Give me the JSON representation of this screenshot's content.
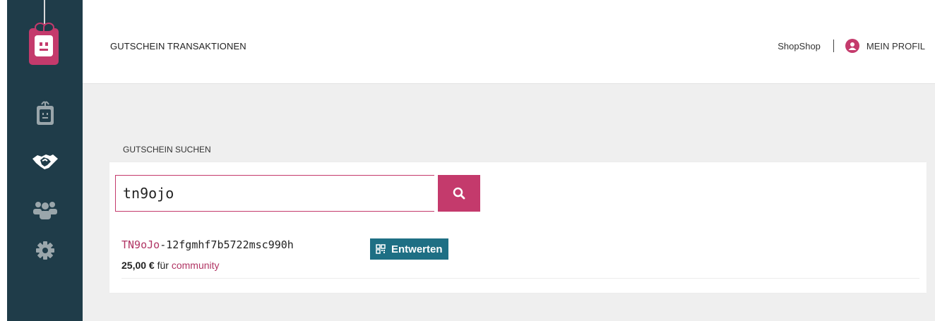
{
  "header": {
    "title": "GUTSCHEIN TRANSAKTIONEN",
    "shop_name": "ShopShop",
    "profile_label": "MEIN PROFIL"
  },
  "sidebar": {
    "logo_icon": "gift-robot-logo-icon",
    "items": [
      {
        "icon": "gift-box-icon",
        "active": false
      },
      {
        "icon": "handshake-icon",
        "active": true
      },
      {
        "icon": "users-icon",
        "active": false
      },
      {
        "icon": "gear-icon",
        "active": false
      }
    ]
  },
  "search": {
    "section_label": "GUTSCHEIN SUCHEN",
    "value": "tn9ojo",
    "button_icon": "search-icon"
  },
  "result": {
    "code_prefix": "TN9oJo",
    "code_rest": "-12fgmhf7b5722msc990h",
    "redeem_label": "Entwerten",
    "amount": "25,00 €",
    "for_text": "für",
    "target": "community"
  },
  "colors": {
    "sidebar": "#1f3c49",
    "accent": "#c43a6c",
    "redeem": "#1e6f84"
  }
}
